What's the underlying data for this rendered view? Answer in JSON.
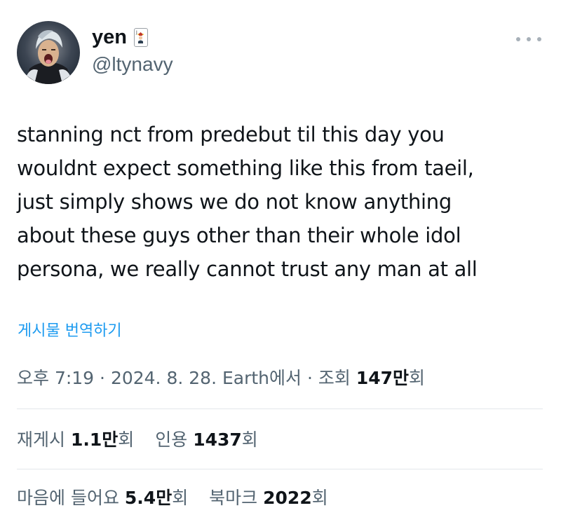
{
  "author": {
    "display_name": "yen",
    "handle": "@ltynavy",
    "badge_icon": "joker-card-icon"
  },
  "menu": {
    "icon": "more-icon"
  },
  "tweet": {
    "text": "stanning nct from predebut til this day you\nwouldnt expect something like this from taeil,\njust simply shows we do not know anything\nabout these guys other than their whole idol\npersona, we really cannot trust any man at all",
    "translate_label": "게시물 번역하기"
  },
  "meta": {
    "time": "오후 7:19",
    "separator": " · ",
    "date": "2024. 8. 28.",
    "location": "Earth에서",
    "views_label": "조회",
    "views_value": "147만",
    "views_suffix": "회"
  },
  "stats": {
    "reposts_label": "재게시",
    "reposts_value": "1.1만",
    "reposts_suffix": "회",
    "quotes_label": "인용",
    "quotes_value": "1437",
    "quotes_suffix": "회",
    "likes_label": "마음에 들어요",
    "likes_value": "5.4만",
    "likes_suffix": "회",
    "bookmarks_label": "북마크",
    "bookmarks_value": "2022",
    "bookmarks_suffix": "회"
  },
  "colors": {
    "text_primary": "#0f1419",
    "text_secondary": "#536471",
    "link": "#1d9bf0",
    "divider": "#e3e7ea"
  }
}
